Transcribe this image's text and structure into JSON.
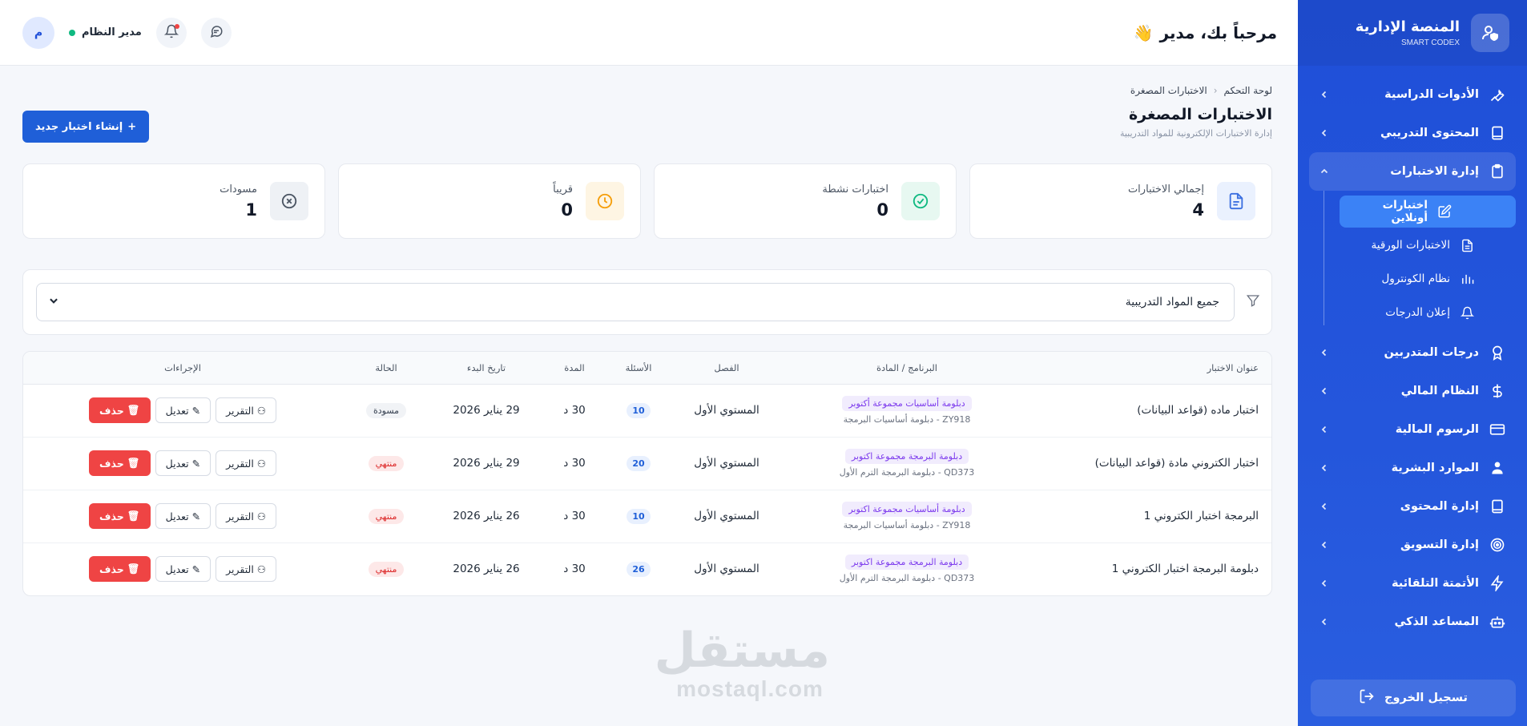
{
  "brand": {
    "title": "المنصة الإدارية",
    "subtitle": "SMART CODEX"
  },
  "sidebar": {
    "items": [
      {
        "label": "الأدوات الدراسية",
        "icon": "wrench-icon"
      },
      {
        "label": "المحتوى التدريبي",
        "icon": "book-icon"
      },
      {
        "label": "إدارة الاختبارات",
        "icon": "clipboard-icon"
      },
      {
        "label": "درجات المتدربين",
        "icon": "award-icon"
      },
      {
        "label": "النظام المالي",
        "icon": "dollar-icon"
      },
      {
        "label": "الرسوم المالية",
        "icon": "card-icon"
      },
      {
        "label": "الموارد البشرية",
        "icon": "people-icon"
      },
      {
        "label": "إدارة المحتوى",
        "icon": "book-icon"
      },
      {
        "label": "إدارة التسويق",
        "icon": "target-icon"
      },
      {
        "label": "الأتمتة التلقائية",
        "icon": "bolt-icon"
      },
      {
        "label": "المساعد الذكي",
        "icon": "robot-icon"
      }
    ],
    "subitems": [
      {
        "label": "اختبارات أونلاين",
        "icon": "edit-icon"
      },
      {
        "label": "الاختبارات الورقية",
        "icon": "document-icon"
      },
      {
        "label": "نظام الكونترول",
        "icon": "bars-icon"
      },
      {
        "label": "إعلان الدرجات",
        "icon": "bell-icon"
      }
    ],
    "logout": "تسجيل الخروج"
  },
  "header": {
    "welcome": "مرحباً بك، مدير",
    "welcome_emoji": "👋",
    "user_name": "مدير النظام",
    "avatar_letter": "م"
  },
  "breadcrumb": {
    "home": "لوحة التحكم",
    "current": "الاختبارات المصغرة"
  },
  "page": {
    "title": "الاختبارات المصغرة",
    "subtitle": "إدارة الاختبارات الإلكترونية للمواد التدريبية",
    "create_button": "إنشاء اختبار جديد",
    "create_plus": "+"
  },
  "stats": [
    {
      "label": "إجمالي الاختبارات",
      "value": "4",
      "icon": "document-icon",
      "color": "#3b6fe0",
      "bg": "#eaf1fe"
    },
    {
      "label": "اختبارات نشطة",
      "value": "0",
      "icon": "check-circle-icon",
      "color": "#10b981",
      "bg": "#e7f8f1"
    },
    {
      "label": "قريباً",
      "value": "0",
      "icon": "clock-icon",
      "color": "#f59e0b",
      "bg": "#fef5e3"
    },
    {
      "label": "مسودات",
      "value": "1",
      "icon": "x-circle-icon",
      "color": "#6b7280",
      "bg": "#eef1f5"
    }
  ],
  "filter": {
    "selected": "جميع المواد التدريبية"
  },
  "table": {
    "headers": [
      "عنوان الاختبار",
      "البرنامج / المادة",
      "الفصل",
      "الأسئلة",
      "المدة",
      "تاريخ البدء",
      "الحالة",
      "الإجراءات"
    ],
    "rows": [
      {
        "title": "اختبار ماده (قواعد البيانات)",
        "program": "دبلومة أساسيات مجموعة أكتوبر",
        "course": "ZY918 - دبلومة أساسيات البرمجة",
        "term": "المستوي الأول",
        "questions": "10",
        "duration": "30 د",
        "start": "29 يناير 2026",
        "status": "مسودة",
        "status_type": "draft"
      },
      {
        "title": "اختبار الكتروني مادة (قواعد البيانات)",
        "program": "دبلومة البرمجة مجموعة اكتوبر",
        "course": "QD373 - دبلومة البرمجة الترم الأول",
        "term": "المستوي الأول",
        "questions": "20",
        "duration": "30 د",
        "start": "29 يناير 2026",
        "status": "منتهي",
        "status_type": "ended"
      },
      {
        "title": "البرمجة اختبار الكتروني 1",
        "program": "دبلومة أساسيات مجموعة اكتوبر",
        "course": "ZY918 - دبلومة أساسيات البرمجة",
        "term": "المستوي الأول",
        "questions": "10",
        "duration": "30 د",
        "start": "26 يناير 2026",
        "status": "منتهي",
        "status_type": "ended"
      },
      {
        "title": "دبلومة البرمجة اختبار الكتروني 1",
        "program": "دبلومة البرمجة مجموعة اكتوبر",
        "course": "QD373 - دبلومة البرمجة الترم الأول",
        "term": "المستوي الأول",
        "questions": "26",
        "duration": "30 د",
        "start": "26 يناير 2026",
        "status": "منتهي",
        "status_type": "ended"
      }
    ],
    "actions": {
      "report": "التقرير",
      "edit": "تعديل",
      "delete": "حذف"
    }
  },
  "watermark": {
    "arabic": "مستقل",
    "latin": "mostaql.com"
  }
}
